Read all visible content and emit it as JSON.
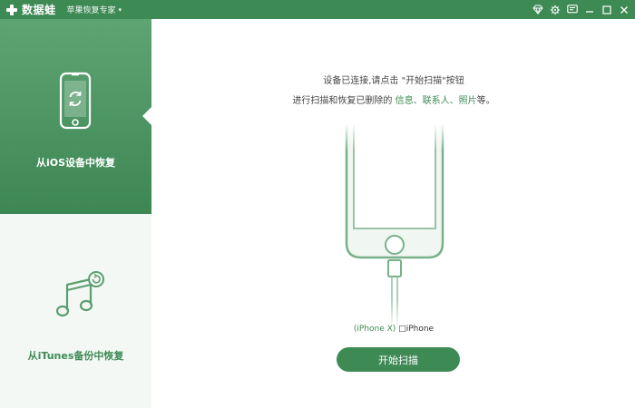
{
  "titlebar": {
    "app_name": "数据蛙",
    "product": "苹果恢复专家",
    "caret": "▾",
    "icons": [
      "diamond-icon",
      "settings-icon",
      "feedback-icon",
      "minimize-icon",
      "maximize-icon",
      "close-icon"
    ]
  },
  "sidebar": {
    "items": [
      {
        "label": "从iOS设备中恢复",
        "active": true
      },
      {
        "label": "从iTunes备份中恢复",
        "active": false
      }
    ]
  },
  "main": {
    "hint_line1": "设备已连接,请点击 \"开始扫描\"按钮",
    "hint_line2_prefix": "进行扫描和恢复已删除的 ",
    "hint_link1": "信息",
    "hint_sep1": "、",
    "hint_link2": "联系人",
    "hint_sep2": "、",
    "hint_link3": "照片",
    "hint_line2_suffix": "等。",
    "device_model": "(iPhone X)",
    "device_name": "□iPhone",
    "start_button": "开始扫描"
  },
  "colors": {
    "brand_green": "#3e8a55",
    "sidebar_bg": "#f3f8f4"
  }
}
